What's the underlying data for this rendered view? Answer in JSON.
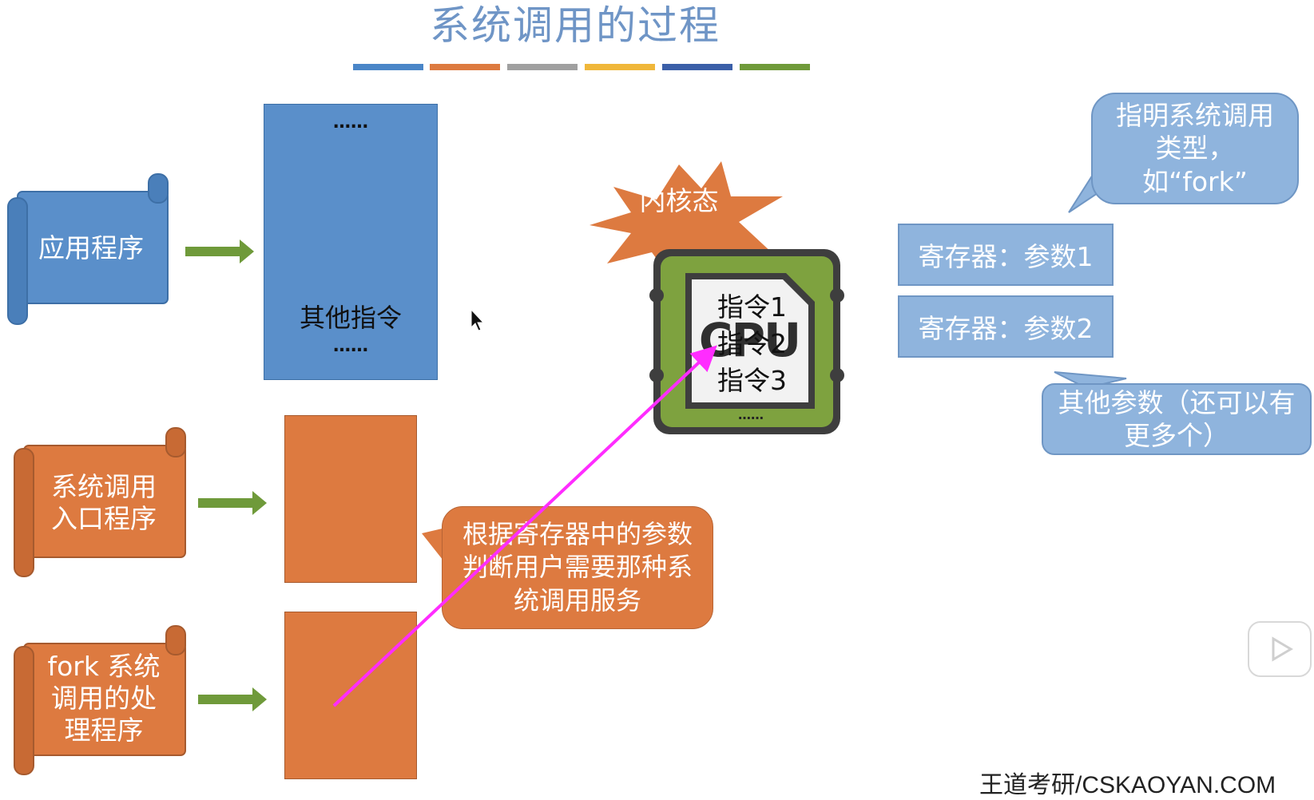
{
  "title": "系统调用的过程",
  "stripe_colors": [
    "#4a86c8",
    "#dd7a40",
    "#a0a0a0",
    "#f0b73a",
    "#3b5fa8",
    "#6f9a3a"
  ],
  "memory": {
    "dots_top": "……",
    "other_instructions": "其他指令",
    "dots_bottom": "……"
  },
  "scrolls": {
    "app": "应用程序",
    "entry": "系统调用入口程序",
    "fork": "fork 系统调用的处理程序"
  },
  "kernel_badge": "内核态",
  "cpu": {
    "logo": "CPU",
    "instr1": "指令1",
    "instr2": "指令2",
    "instr3": "指令3",
    "dots": "……"
  },
  "callout_orange": "根据寄存器中的参数判断用户需要那种系统调用服务",
  "callout_type": "指明系统调用类型，如“fork”",
  "registers": {
    "reg1": "寄存器：参数1",
    "reg2": "寄存器：参数2"
  },
  "callout_other": "其他参数（还可以有更多个）",
  "footer": "王道考研/CSKAOYAN.COM",
  "colors": {
    "blue": "#5a8fca",
    "orange": "#dd7a40",
    "green_arrow": "#6f9a3a",
    "light_blue": "#8fb4dd",
    "magenta_arrow": "#ff2cff",
    "cpu_green": "#7ea23f"
  }
}
